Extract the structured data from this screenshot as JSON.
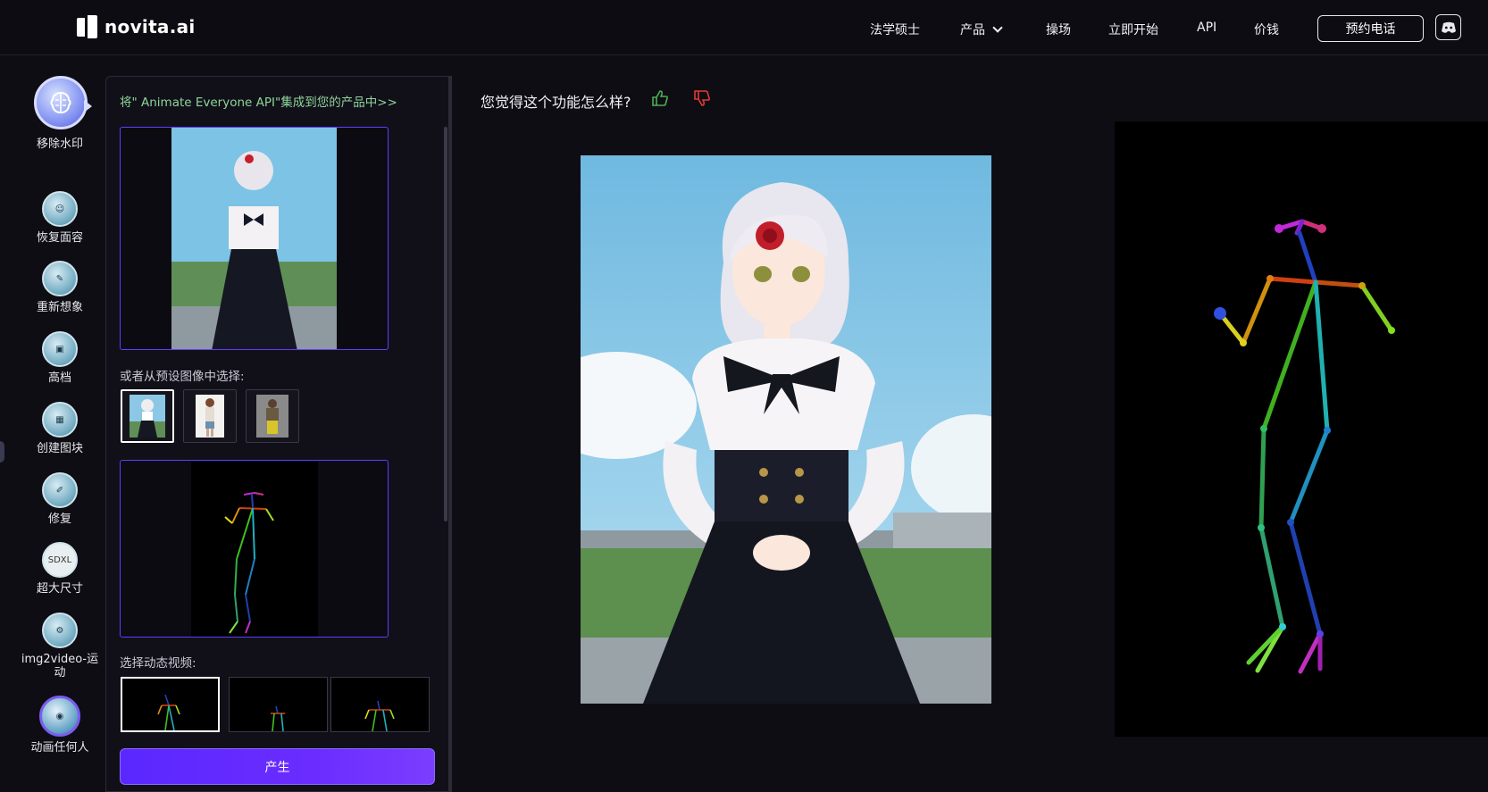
{
  "brand": {
    "name": "novita.ai"
  },
  "nav": {
    "items": [
      "法学硕士",
      "产品",
      "操场",
      "立即开始",
      "API",
      "价钱"
    ],
    "cta": "预约电话"
  },
  "rail": {
    "items": [
      {
        "label": "移除水印",
        "icon": "watermark-remove-icon"
      },
      {
        "label": "恢复面容",
        "icon": "face-restore-icon"
      },
      {
        "label": "重新想象",
        "icon": "reimagine-icon"
      },
      {
        "label": "高档",
        "icon": "upscale-icon"
      },
      {
        "label": "创建图块",
        "icon": "tile-icon"
      },
      {
        "label": "修复",
        "icon": "repair-icon"
      },
      {
        "label": "超大尺寸",
        "icon": "sdxl-icon",
        "badge": "SDXL"
      },
      {
        "label": "img2video-运动",
        "icon": "img2video-icon"
      },
      {
        "label": "动画任何人",
        "icon": "animate-anyone-icon",
        "active": true
      }
    ]
  },
  "panel": {
    "api_link": "将\" Animate Everyone API\"集成到您的产品中>>",
    "preset_label": "或者从预设图像中选择:",
    "motion_label": "选择动态视频:",
    "generate": "产生"
  },
  "main": {
    "feedback_question": "您觉得这个功能怎么样?"
  },
  "colors": {
    "accent": "#5f3dff",
    "link": "#8fd59a",
    "thumb_up": "#4caf50",
    "thumb_down": "#e53935"
  }
}
